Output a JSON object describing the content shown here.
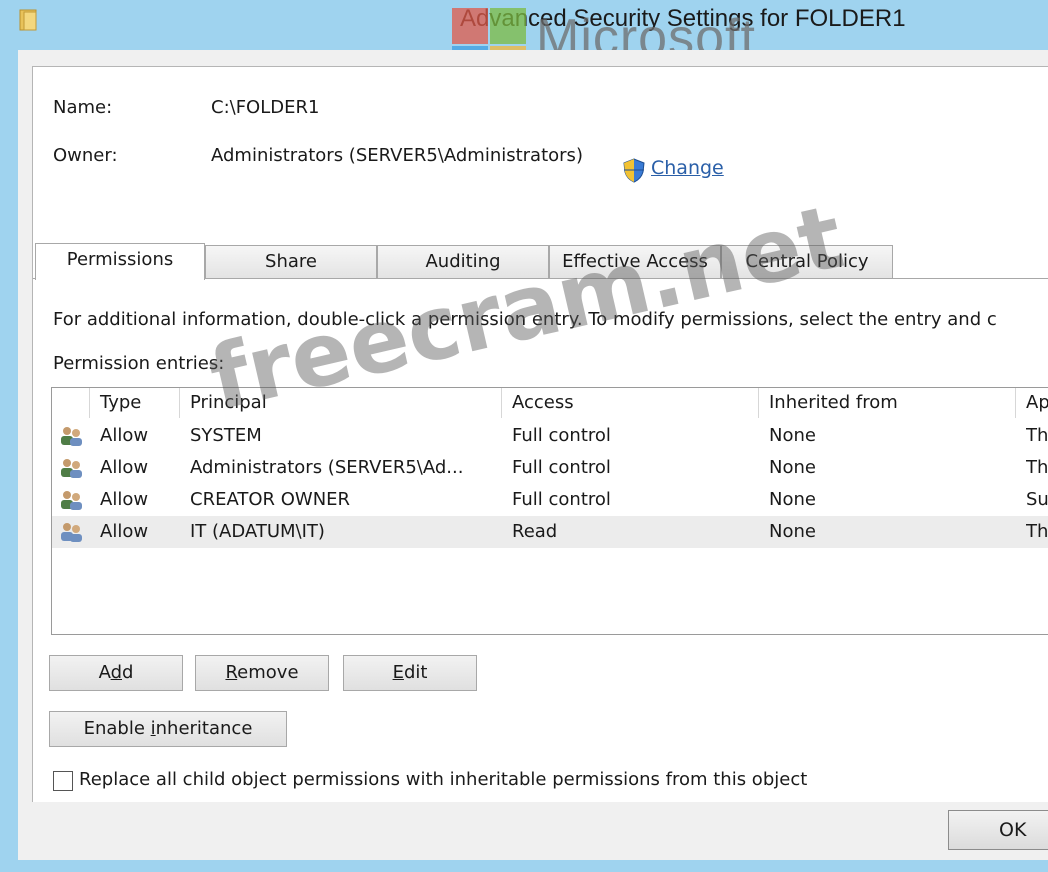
{
  "window": {
    "title": "Advanced Security Settings for FOLDER1"
  },
  "watermarks": {
    "brand": "Microsoft",
    "site": "freecram.net"
  },
  "header": {
    "name_label": "Name:",
    "name_value": "C:\\FOLDER1",
    "owner_label": "Owner:",
    "owner_value": "Administrators (SERVER5\\Administrators)",
    "change_link": "Change"
  },
  "tabs": [
    {
      "label": "Permissions",
      "active": true
    },
    {
      "label": "Share",
      "active": false
    },
    {
      "label": "Auditing",
      "active": false
    },
    {
      "label": "Effective Access",
      "active": false
    },
    {
      "label": "Central Policy",
      "active": false
    }
  ],
  "permissions": {
    "info_text": "For additional information, double-click a permission entry. To modify permissions, select the entry and c",
    "entries_label": "Permission entries:",
    "columns": [
      "Type",
      "Principal",
      "Access",
      "Inherited from",
      "Ap"
    ],
    "rows": [
      {
        "type": "Allow",
        "principal": "SYSTEM",
        "access": "Full control",
        "inherited": "None",
        "applies": "Th"
      },
      {
        "type": "Allow",
        "principal": "Administrators (SERVER5\\Ad...",
        "access": "Full control",
        "inherited": "None",
        "applies": "Th"
      },
      {
        "type": "Allow",
        "principal": "CREATOR OWNER",
        "access": "Full control",
        "inherited": "None",
        "applies": "Su"
      },
      {
        "type": "Allow",
        "principal": "IT (ADATUM\\IT)",
        "access": "Read",
        "inherited": "None",
        "applies": "Th"
      }
    ],
    "selected_row": 3
  },
  "buttons": {
    "add": "Add",
    "remove": "Remove",
    "edit": "Edit",
    "enable_inheritance": "Enable inheritance",
    "ok": "OK"
  },
  "replace_checkbox": {
    "label": "Replace all child object permissions with inheritable permissions from this object",
    "checked": false
  },
  "colors": {
    "window_frame": "#9fd3ef",
    "dialog_bg": "#f0f0f0",
    "link": "#2a5fa8"
  }
}
